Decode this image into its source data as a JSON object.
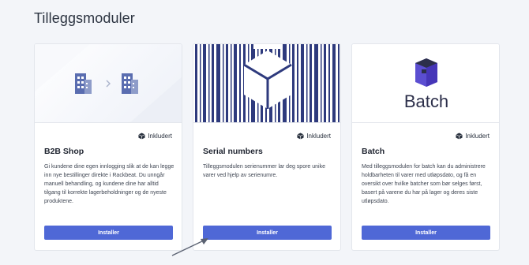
{
  "page": {
    "title": "Tilleggsmoduler"
  },
  "modules": [
    {
      "title": "B2B Shop",
      "badge": "Inkludert",
      "description": "Gi kundene dine egen innlogging slik at de kan legge inn nye bestillinger direkte i Rackbeat. Du unngår manuell behandling, og kundene dine har alltid tilgang til korrekte lagerbeholdninger og de nyeste produktene.",
      "button": "Installer"
    },
    {
      "title": "Serial numbers",
      "badge": "Inkludert",
      "description": "Tilleggsmodulen serienummer lar deg spore unike varer ved hjelp av serienumre.",
      "button": "Installer"
    },
    {
      "title": "Batch",
      "badge": "Inkludert",
      "description": "Med tilleggsmodulen for batch kan du administrere holdbarheten til varer med utløpsdato, og få en oversikt over hvilke batcher som bør selges først, basert på varene du har på lager og deres siste utløpsdato.",
      "button": "Installer",
      "logo_text": "Batch"
    }
  ],
  "colors": {
    "accent": "#4f68d6",
    "logo_dark": "#2c2f4a",
    "background": "#f3f5f9"
  }
}
